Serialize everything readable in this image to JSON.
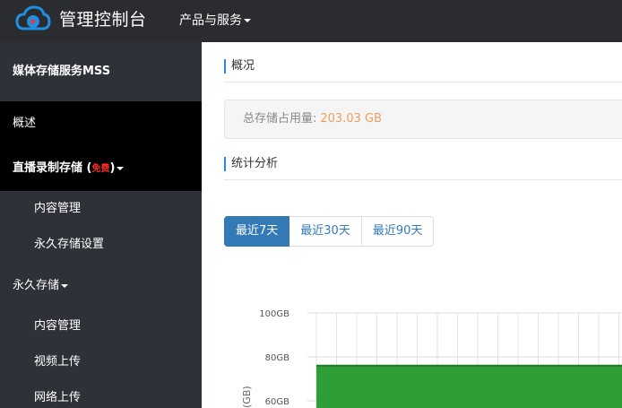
{
  "header": {
    "app_title": "管理控制台",
    "menu_label": "产品与服务"
  },
  "sidebar": {
    "service_title": "媒体存储服务MSS",
    "overview": "概述",
    "live_storage": {
      "label": "直播录制存储 (",
      "free_tag": "免费",
      "suffix": ")"
    },
    "live_items": [
      "内容管理",
      "永久存储设置"
    ],
    "permanent_storage": "永久存储",
    "permanent_items": [
      "内容管理",
      "视频上传",
      "网络上传"
    ]
  },
  "main": {
    "overview_title": "概况",
    "usage_label": "总存储占用量:",
    "usage_value": "203.03 GB",
    "stats_title": "统计分析",
    "range_buttons": [
      "最近7天",
      "最近30天",
      "最近90天"
    ]
  },
  "chart_data": {
    "type": "area",
    "ylabel": "(GB)",
    "y_ticks": [
      "100GB",
      "80GB",
      "60GB"
    ],
    "y_tick_values": [
      100,
      80,
      60
    ],
    "ylim": [
      60,
      100
    ],
    "series": [
      {
        "values": [
          76,
          76,
          76,
          76,
          76,
          76,
          76,
          76,
          76,
          76,
          76,
          76,
          76,
          76,
          76,
          76,
          76
        ]
      }
    ],
    "grid": true,
    "colors": {
      "fill": "#2f9e37",
      "stroke": "#1f7a26"
    }
  }
}
